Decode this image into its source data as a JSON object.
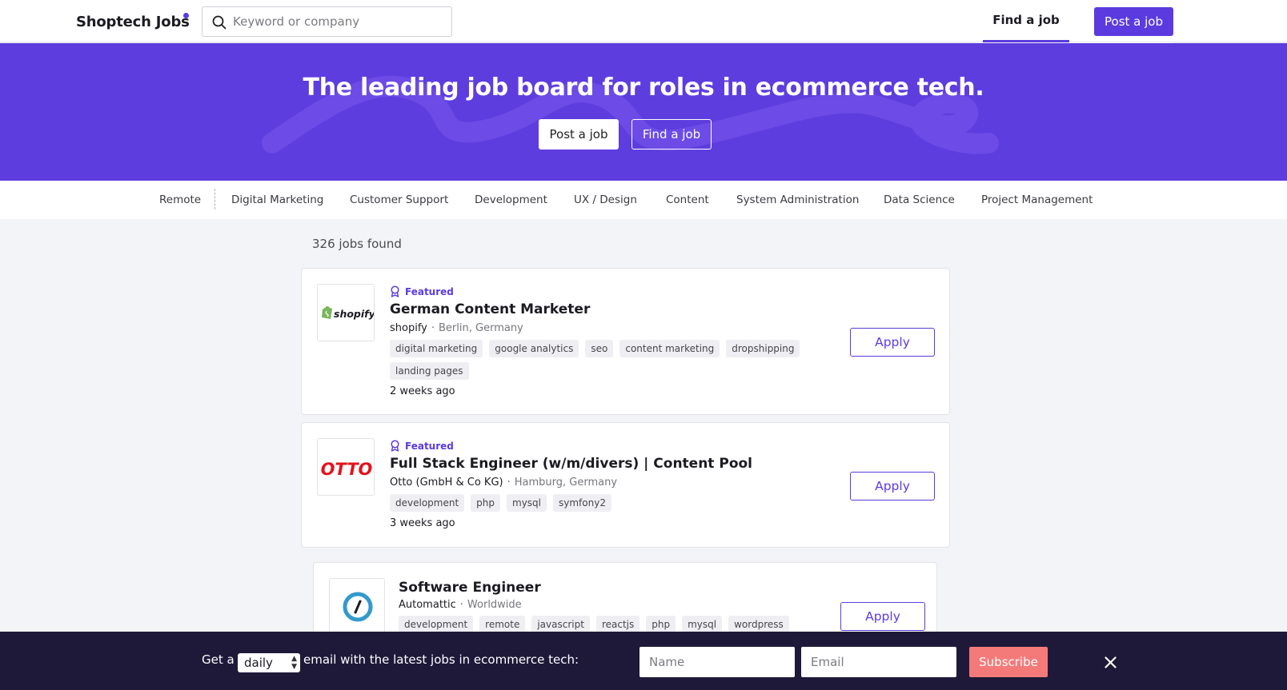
{
  "header": {
    "logo": "Shoptech Jobs",
    "search_placeholder": "Keyword or company",
    "nav_find": "Find a job",
    "nav_post": "Post a job"
  },
  "hero": {
    "title": "The leading job board for roles in ecommerce tech.",
    "post_button": "Post a job",
    "find_button": "Find a job"
  },
  "categories": [
    "Remote",
    "Digital Marketing",
    "Customer Support",
    "Development",
    "UX / Design",
    "Content",
    "System Administration",
    "Data Science",
    "Project Management"
  ],
  "results": {
    "count_text": "326 jobs found"
  },
  "jobs": [
    {
      "featured": "Featured",
      "title": "German Content Marketer",
      "company": "shopify",
      "location": "Berlin, Germany",
      "tags": [
        "digital marketing",
        "google analytics",
        "seo",
        "content marketing",
        "dropshipping",
        "landing pages"
      ],
      "posted": "2 weeks ago",
      "apply": "Apply",
      "logo_text": "shopify"
    },
    {
      "featured": "Featured",
      "title": "Full Stack Engineer (w/m/divers) | Content Pool",
      "company": "Otto (GmbH & Co KG)",
      "location": "Hamburg, Germany",
      "tags": [
        "development",
        "php",
        "mysql",
        "symfony2"
      ],
      "posted": "3 weeks ago",
      "apply": "Apply",
      "logo_text": "OTTO"
    },
    {
      "title": "Software Engineer",
      "company": "Automattic",
      "location": "Worldwide",
      "tags": [
        "development",
        "remote",
        "javascript",
        "reactjs",
        "php",
        "mysql",
        "wordpress"
      ],
      "apply": "Apply"
    }
  ],
  "subscribe": {
    "text_before": "Get a",
    "frequency": "daily",
    "text_after": "email with the latest jobs in ecommerce tech:",
    "name_placeholder": "Name",
    "email_placeholder": "Email",
    "button": "Subscribe"
  },
  "colors": {
    "brand": "#5b3be0",
    "hero_bg": "#5e3ddf",
    "subscribe_bar": "#1e1939",
    "subscribe_button": "#f47a7a"
  }
}
